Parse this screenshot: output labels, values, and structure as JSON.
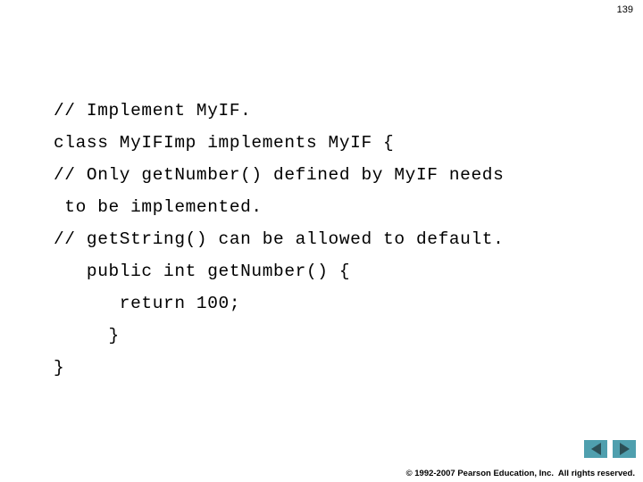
{
  "slide": {
    "page_number": "139",
    "code_lines": [
      "// Implement MyIF.",
      "class MyIFImp implements MyIF {",
      "// Only getNumber() defined by MyIF needs",
      " to be implemented.",
      "// getString() can be allowed to default.",
      "   public int getNumber() {",
      "      return 100;",
      "     }",
      "}"
    ],
    "nav": {
      "prev_label": "Previous slide",
      "next_label": "Next slide",
      "prev_icon": "triangle-left-icon",
      "next_icon": "triangle-right-icon",
      "button_color": "#4f9fae",
      "arrow_color": "#2c4f56"
    },
    "footer": "© 1992-2007 Pearson Education, Inc.  All rights reserved."
  }
}
